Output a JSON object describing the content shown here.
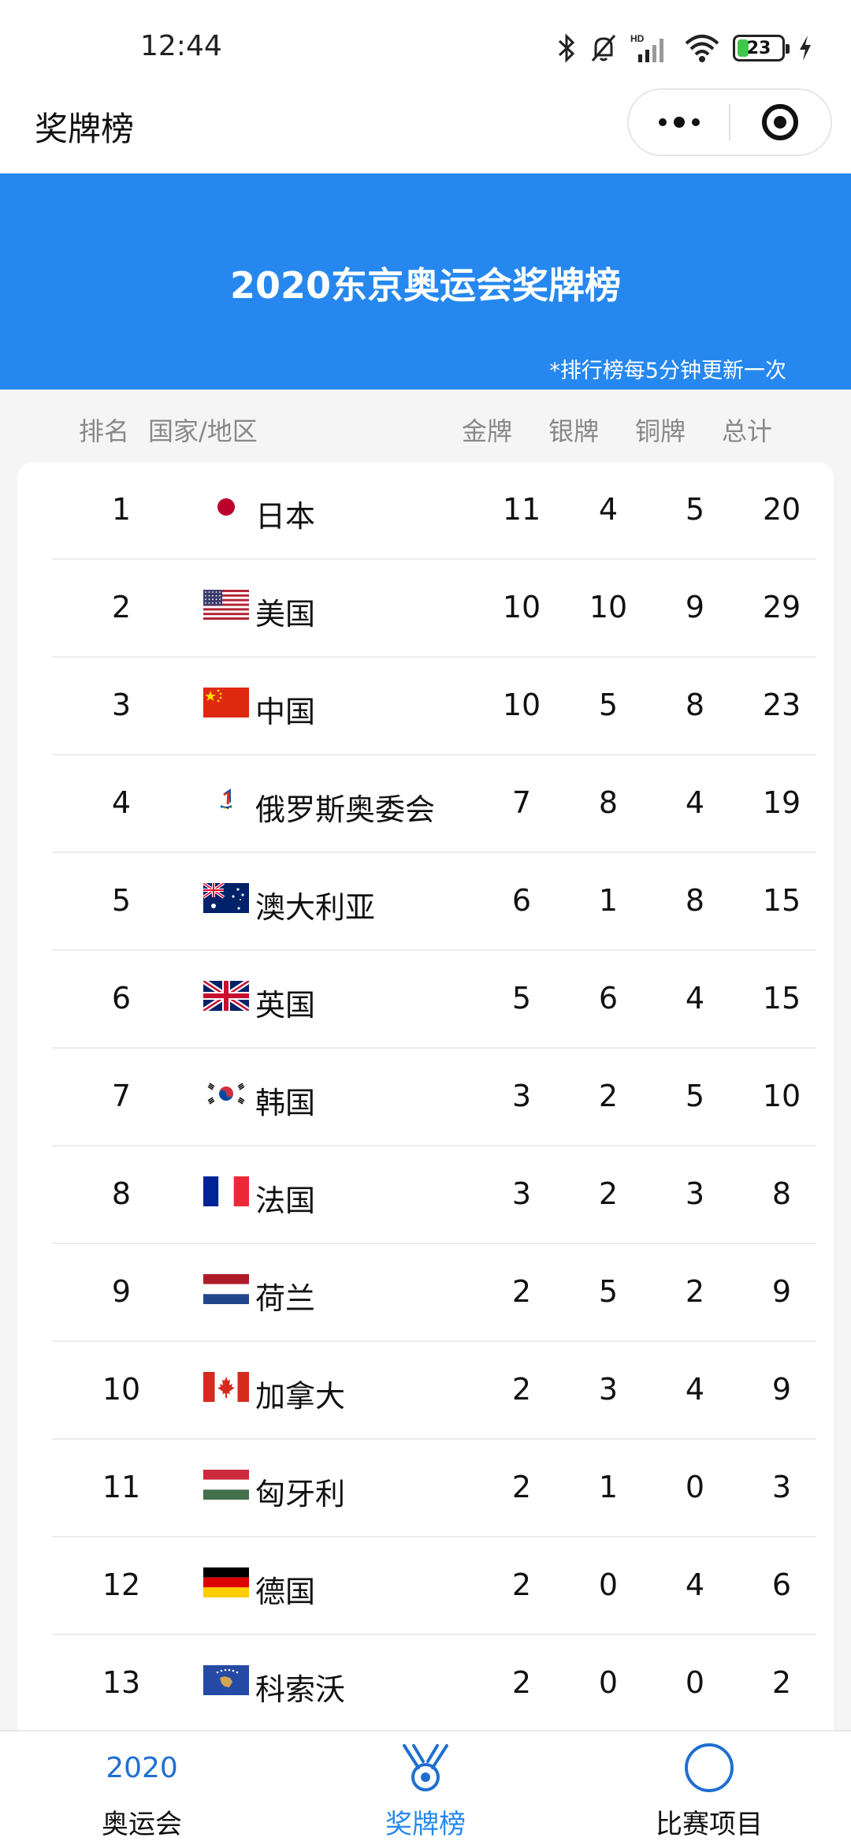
{
  "status": {
    "time": "12:44",
    "battery": "23",
    "icons": [
      "bluetooth-icon",
      "bell-off-icon",
      "hd-signal-icon",
      "wifi-icon",
      "battery-icon",
      "charging-icon"
    ]
  },
  "nav": {
    "title": "奖牌榜"
  },
  "banner": {
    "title": "2020东京奥运会奖牌榜",
    "note": "*排行榜每5分钟更新一次",
    "color": "#2688ee"
  },
  "columns": {
    "rank": "排名",
    "country": "国家/地区",
    "gold": "金牌",
    "silver": "银牌",
    "bronze": "铜牌",
    "total": "总计"
  },
  "rows": [
    {
      "rank": "1",
      "flag": "japan-flag",
      "country": "日本",
      "gold": "11",
      "silver": "4",
      "bronze": "5",
      "total": "20"
    },
    {
      "rank": "2",
      "flag": "usa-flag",
      "country": "美国",
      "gold": "10",
      "silver": "10",
      "bronze": "9",
      "total": "29"
    },
    {
      "rank": "3",
      "flag": "china-flag",
      "country": "中国",
      "gold": "10",
      "silver": "5",
      "bronze": "8",
      "total": "23"
    },
    {
      "rank": "4",
      "flag": "roc-flag",
      "country": "俄罗斯奥委会",
      "gold": "7",
      "silver": "8",
      "bronze": "4",
      "total": "19"
    },
    {
      "rank": "5",
      "flag": "australia-flag",
      "country": "澳大利亚",
      "gold": "6",
      "silver": "1",
      "bronze": "8",
      "total": "15"
    },
    {
      "rank": "6",
      "flag": "uk-flag",
      "country": "英国",
      "gold": "5",
      "silver": "6",
      "bronze": "4",
      "total": "15"
    },
    {
      "rank": "7",
      "flag": "korea-flag",
      "country": "韩国",
      "gold": "3",
      "silver": "2",
      "bronze": "5",
      "total": "10"
    },
    {
      "rank": "8",
      "flag": "france-flag",
      "country": "法国",
      "gold": "3",
      "silver": "2",
      "bronze": "3",
      "total": "8"
    },
    {
      "rank": "9",
      "flag": "netherlands-flag",
      "country": "荷兰",
      "gold": "2",
      "silver": "5",
      "bronze": "2",
      "total": "9"
    },
    {
      "rank": "10",
      "flag": "canada-flag",
      "country": "加拿大",
      "gold": "2",
      "silver": "3",
      "bronze": "4",
      "total": "9"
    },
    {
      "rank": "11",
      "flag": "hungary-flag",
      "country": "匈牙利",
      "gold": "2",
      "silver": "1",
      "bronze": "0",
      "total": "3"
    },
    {
      "rank": "12",
      "flag": "germany-flag",
      "country": "德国",
      "gold": "2",
      "silver": "0",
      "bronze": "4",
      "total": "6"
    },
    {
      "rank": "13",
      "flag": "kosovo-flag",
      "country": "科索沃",
      "gold": "2",
      "silver": "0",
      "bronze": "0",
      "total": "2"
    }
  ],
  "tabs": [
    {
      "icon_text": "2020",
      "label": "奥运会",
      "active": false
    },
    {
      "icon": "medal-icon",
      "label": "奖牌榜",
      "active": true
    },
    {
      "icon": "ring-icon",
      "label": "比赛项目",
      "active": false
    }
  ]
}
